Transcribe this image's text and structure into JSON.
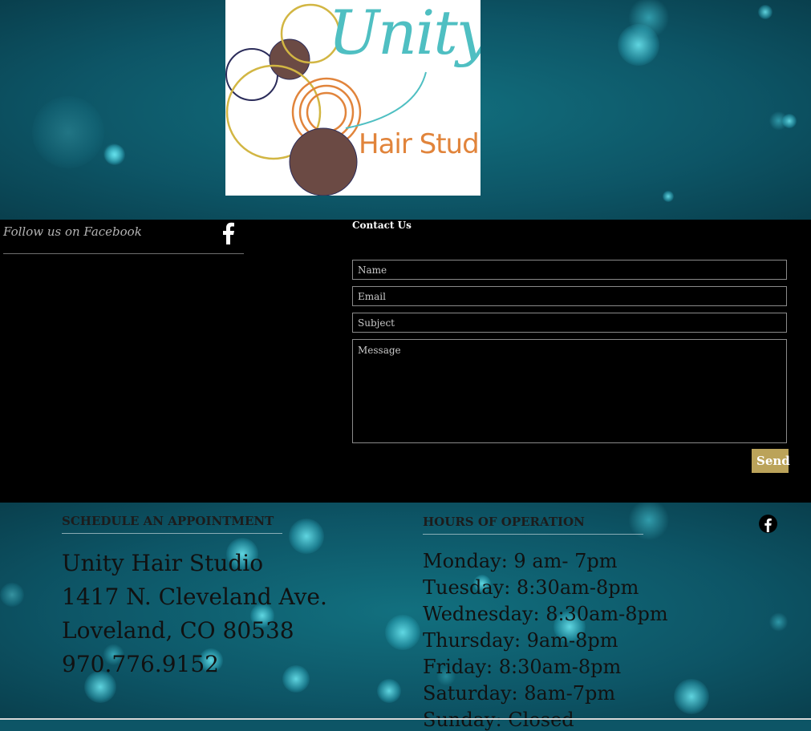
{
  "logo": {
    "wordmark": "Unity",
    "tagline": "Hair Studio",
    "colors": {
      "teal": "#4fbfc2",
      "brown": "#6b4a44",
      "gold": "#d2b643",
      "orange": "#e1843b",
      "navy": "#2b2c5a"
    }
  },
  "follow": {
    "label": "Follow us on Facebook",
    "icon": "facebook-f-icon"
  },
  "contact": {
    "title": "Contact Us",
    "name_placeholder": "Name",
    "email_placeholder": "Email",
    "subject_placeholder": "Subject",
    "message_placeholder": "Message",
    "send_label": "Send",
    "send_color": "#bba35a"
  },
  "appointment": {
    "title": "SCHEDULE AN APPOINTMENT",
    "lines": [
      "Unity Hair Studio",
      "1417 N. Cleveland Ave.",
      "Loveland, CO 80538",
      "970.776.9152"
    ]
  },
  "hours": {
    "title": "HOURS OF OPERATION",
    "lines": [
      "Monday: 9 am- 7pm",
      "Tuesday: 8:30am-8pm",
      "Wednesday: 8:30am-8pm",
      "Thursday: 9am-8pm",
      "Friday: 8:30am-8pm",
      "Saturday: 8am-7pm",
      "Sunday: Closed"
    ]
  },
  "social": {
    "icon": "facebook-circle-icon"
  }
}
